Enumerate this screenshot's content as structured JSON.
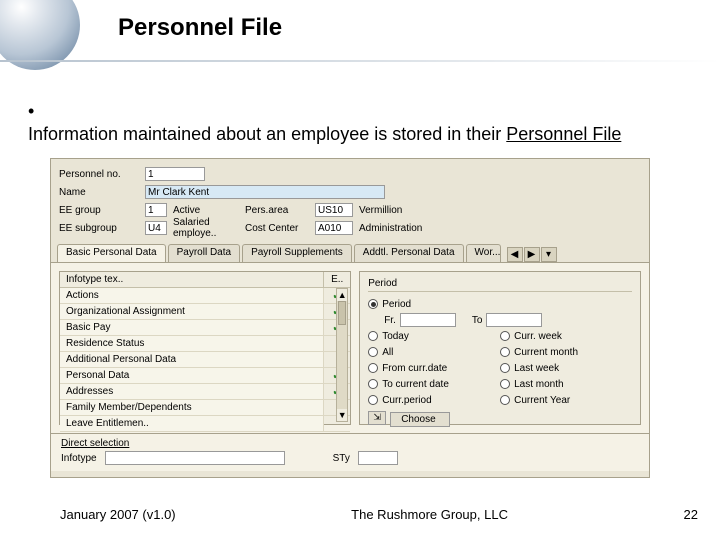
{
  "slide": {
    "title": "Personnel File",
    "bullet_text_pre": "Information maintained about an employee is stored in their ",
    "bullet_text_ul": "Personnel File",
    "footer_left": "January 2007 (v1.0)",
    "footer_center": "The Rushmore Group, LLC",
    "slide_number": "22"
  },
  "header": {
    "labels": {
      "pers_no": "Personnel no.",
      "name": "Name",
      "ee_group": "EE group",
      "ee_subgroup": "EE subgroup",
      "pers_area": "Pers.area",
      "cost_center": "Cost Center"
    },
    "pers_no_value": "1",
    "name_value": "Mr Clark Kent",
    "ee_group_value": "1",
    "ee_group_text": "Active",
    "ee_subgroup_value": "U4",
    "ee_subgroup_text": "Salaried employe..",
    "pers_area_value": "US10",
    "pers_area_text": "Vermillion",
    "cost_center_value": "A010",
    "cost_center_text": "Administration"
  },
  "tabs": {
    "items": [
      "Basic Personal Data",
      "Payroll Data",
      "Payroll Supplements",
      "Addtl. Personal Data",
      "Wor..."
    ]
  },
  "infotype_list": {
    "col_head_a": "Infotype tex..",
    "col_head_b": "E..",
    "rows": [
      {
        "label": "Actions",
        "checked": true
      },
      {
        "label": "Organizational Assignment",
        "checked": true
      },
      {
        "label": "Basic Pay",
        "checked": true
      },
      {
        "label": "Residence Status",
        "checked": false
      },
      {
        "label": "Additional Personal Data",
        "checked": false
      },
      {
        "label": "Personal Data",
        "checked": true
      },
      {
        "label": "Addresses",
        "checked": true
      },
      {
        "label": "Family Member/Dependents",
        "checked": false
      },
      {
        "label": "Leave Entitlemen..",
        "checked": false
      }
    ]
  },
  "period": {
    "title": "Period",
    "option_period": "Period",
    "fr_label": "Fr.",
    "to_label": "To",
    "options_left": [
      "Today",
      "All",
      "From curr.date",
      "To current date",
      "Curr.period"
    ],
    "options_right": [
      "Curr. week",
      "Current month",
      "Last week",
      "Last month",
      "Current Year"
    ],
    "choose_label": "Choose"
  },
  "direct_selection": {
    "title": "Direct selection",
    "infotype_label": "Infotype",
    "sty_label": "STy"
  }
}
